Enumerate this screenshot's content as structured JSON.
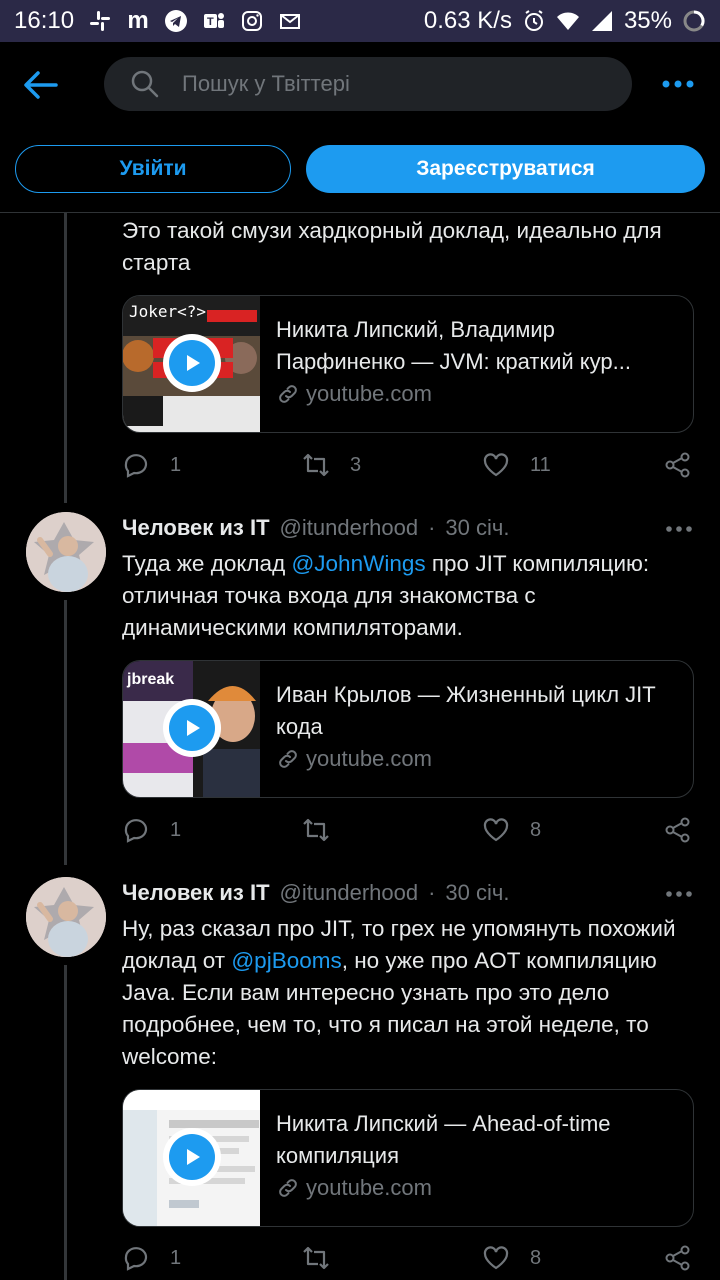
{
  "status_bar": {
    "time": "16:10",
    "net_speed": "0.63 K/s",
    "battery": "35%",
    "left_icons": [
      "slack-icon",
      "m-icon",
      "telegram-icon",
      "teams-icon",
      "instagram-icon",
      "gmail-icon"
    ]
  },
  "header": {
    "search_placeholder": "Пошук у Твіттері"
  },
  "auth": {
    "login_label": "Увійти",
    "signup_label": "Зареєструватися"
  },
  "tweets": [
    {
      "text": "Это такой смузи хардкорный доклад, идеально для старта",
      "card": {
        "title": "Никита Липский, Владимир Парфиненко — JVM: краткий кур...",
        "domain": "youtube.com",
        "thumb_label": "Joker<?>"
      },
      "replies": "1",
      "retweets": "3",
      "likes": "11"
    },
    {
      "name": "Человек из IT",
      "handle": "@itunderhood",
      "dot": "·",
      "date": "30 січ.",
      "text_before": "Туда же доклад ",
      "mention": "@JohnWings",
      "text_after": " про JIT компиляцию: отличная точка входа для знакомства с динамическими компиляторами.",
      "card": {
        "title": "Иван Крылов — Жизненный цикл JIT кода",
        "domain": "youtube.com",
        "thumb_label": "jbreak"
      },
      "replies": "1",
      "retweets": "",
      "likes": "8"
    },
    {
      "name": "Человек из IT",
      "handle": "@itunderhood",
      "dot": "·",
      "date": "30 січ.",
      "text_before": "Ну, раз сказал про JIT, то грех не упомянуть похожий доклад от ",
      "mention": "@pjBooms",
      "text_after": ", но уже про AOT компиляцию Java. Если вам интересно узнать про это дело подробнее, чем то, что я писал на этой неделе, то welcome:",
      "card": {
        "title": "Никита Липский — Ahead-of-time компиляция",
        "domain": "youtube.com",
        "thumb_label": ""
      },
      "replies": "1",
      "retweets": "",
      "likes": "8"
    }
  ],
  "colors": {
    "accent": "#1d9bf0",
    "status_bar_bg": "#2b2947",
    "muted": "#71767b"
  }
}
